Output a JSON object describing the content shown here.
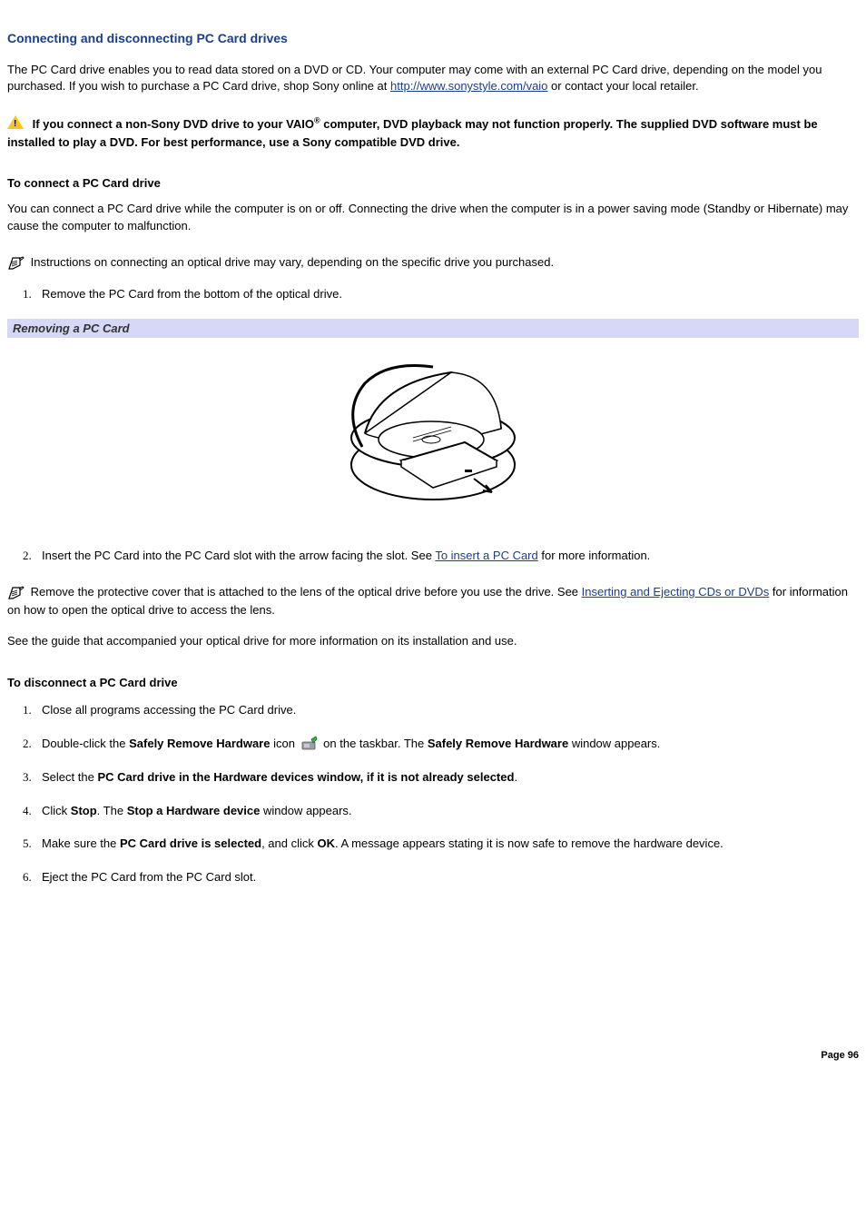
{
  "title": "Connecting and disconnecting PC Card drives",
  "intro_pre": "The PC Card drive enables you to read data stored on a DVD or CD. Your computer may come with an external PC Card drive, depending on the model you purchased. If you wish to purchase a PC Card drive, shop Sony online at ",
  "intro_link": "http://www.sonystyle.com/vaio",
  "intro_post": " or contact your local retailer.",
  "warning_pre": "If you connect a non-Sony DVD drive to your VAIO",
  "warning_reg": "®",
  "warning_post": " computer, DVD playback may not function properly. The supplied DVD software must be installed to play a DVD. For best performance, use a Sony compatible DVD drive.",
  "connect_head": "To connect a PC Card drive",
  "connect_p1": "You can connect a PC Card drive while the computer is on or off. Connecting the drive when the computer is in a power saving mode (Standby or Hibernate) may cause the computer to malfunction.",
  "connect_note": "Instructions on connecting an optical drive may vary, depending on the specific drive you purchased.",
  "connect_steps": {
    "s1": "Remove the PC Card from the bottom of the optical drive.",
    "s2_pre": "Insert the PC Card into the PC Card slot with the arrow facing the slot. See ",
    "s2_link": "To insert a PC Card",
    "s2_post": " for more information."
  },
  "caption": "Removing a PC Card",
  "lens_note_pre": "Remove the protective cover that is attached to the lens of the optical drive before you use the drive. See ",
  "lens_note_link": "Inserting and Ejecting CDs or DVDs",
  "lens_note_post": " for information on how to open the optical drive to access the lens.",
  "see_guide": "See the guide that accompanied your optical drive for more information on its installation and use.",
  "disconnect_head": "To disconnect a PC Card drive",
  "disconnect_steps": {
    "d1": "Close all programs accessing the PC Card drive.",
    "d2_pre": "Double-click the ",
    "d2_bold1": "Safely Remove Hardware",
    "d2_mid1": " icon ",
    "d2_mid2": " on the taskbar. The ",
    "d2_bold2": "Safely Remove Hardware",
    "d2_post": " window appears.",
    "d3_pre": "Select the ",
    "d3_bold": "PC Card drive in the Hardware devices window, if it is not already selected",
    "d3_post": ".",
    "d4_pre": "Click ",
    "d4_bold1": "Stop",
    "d4_mid": ". The ",
    "d4_bold2": "Stop a Hardware device",
    "d4_post": " window appears.",
    "d5_pre": "Make sure the ",
    "d5_bold1": "PC Card drive is selected",
    "d5_mid1": ", and click ",
    "d5_bold2": "OK",
    "d5_post": ". A message appears stating it is now safe to remove the hardware device.",
    "d6": "Eject the PC Card from the PC Card slot."
  },
  "page_num": "Page 96"
}
